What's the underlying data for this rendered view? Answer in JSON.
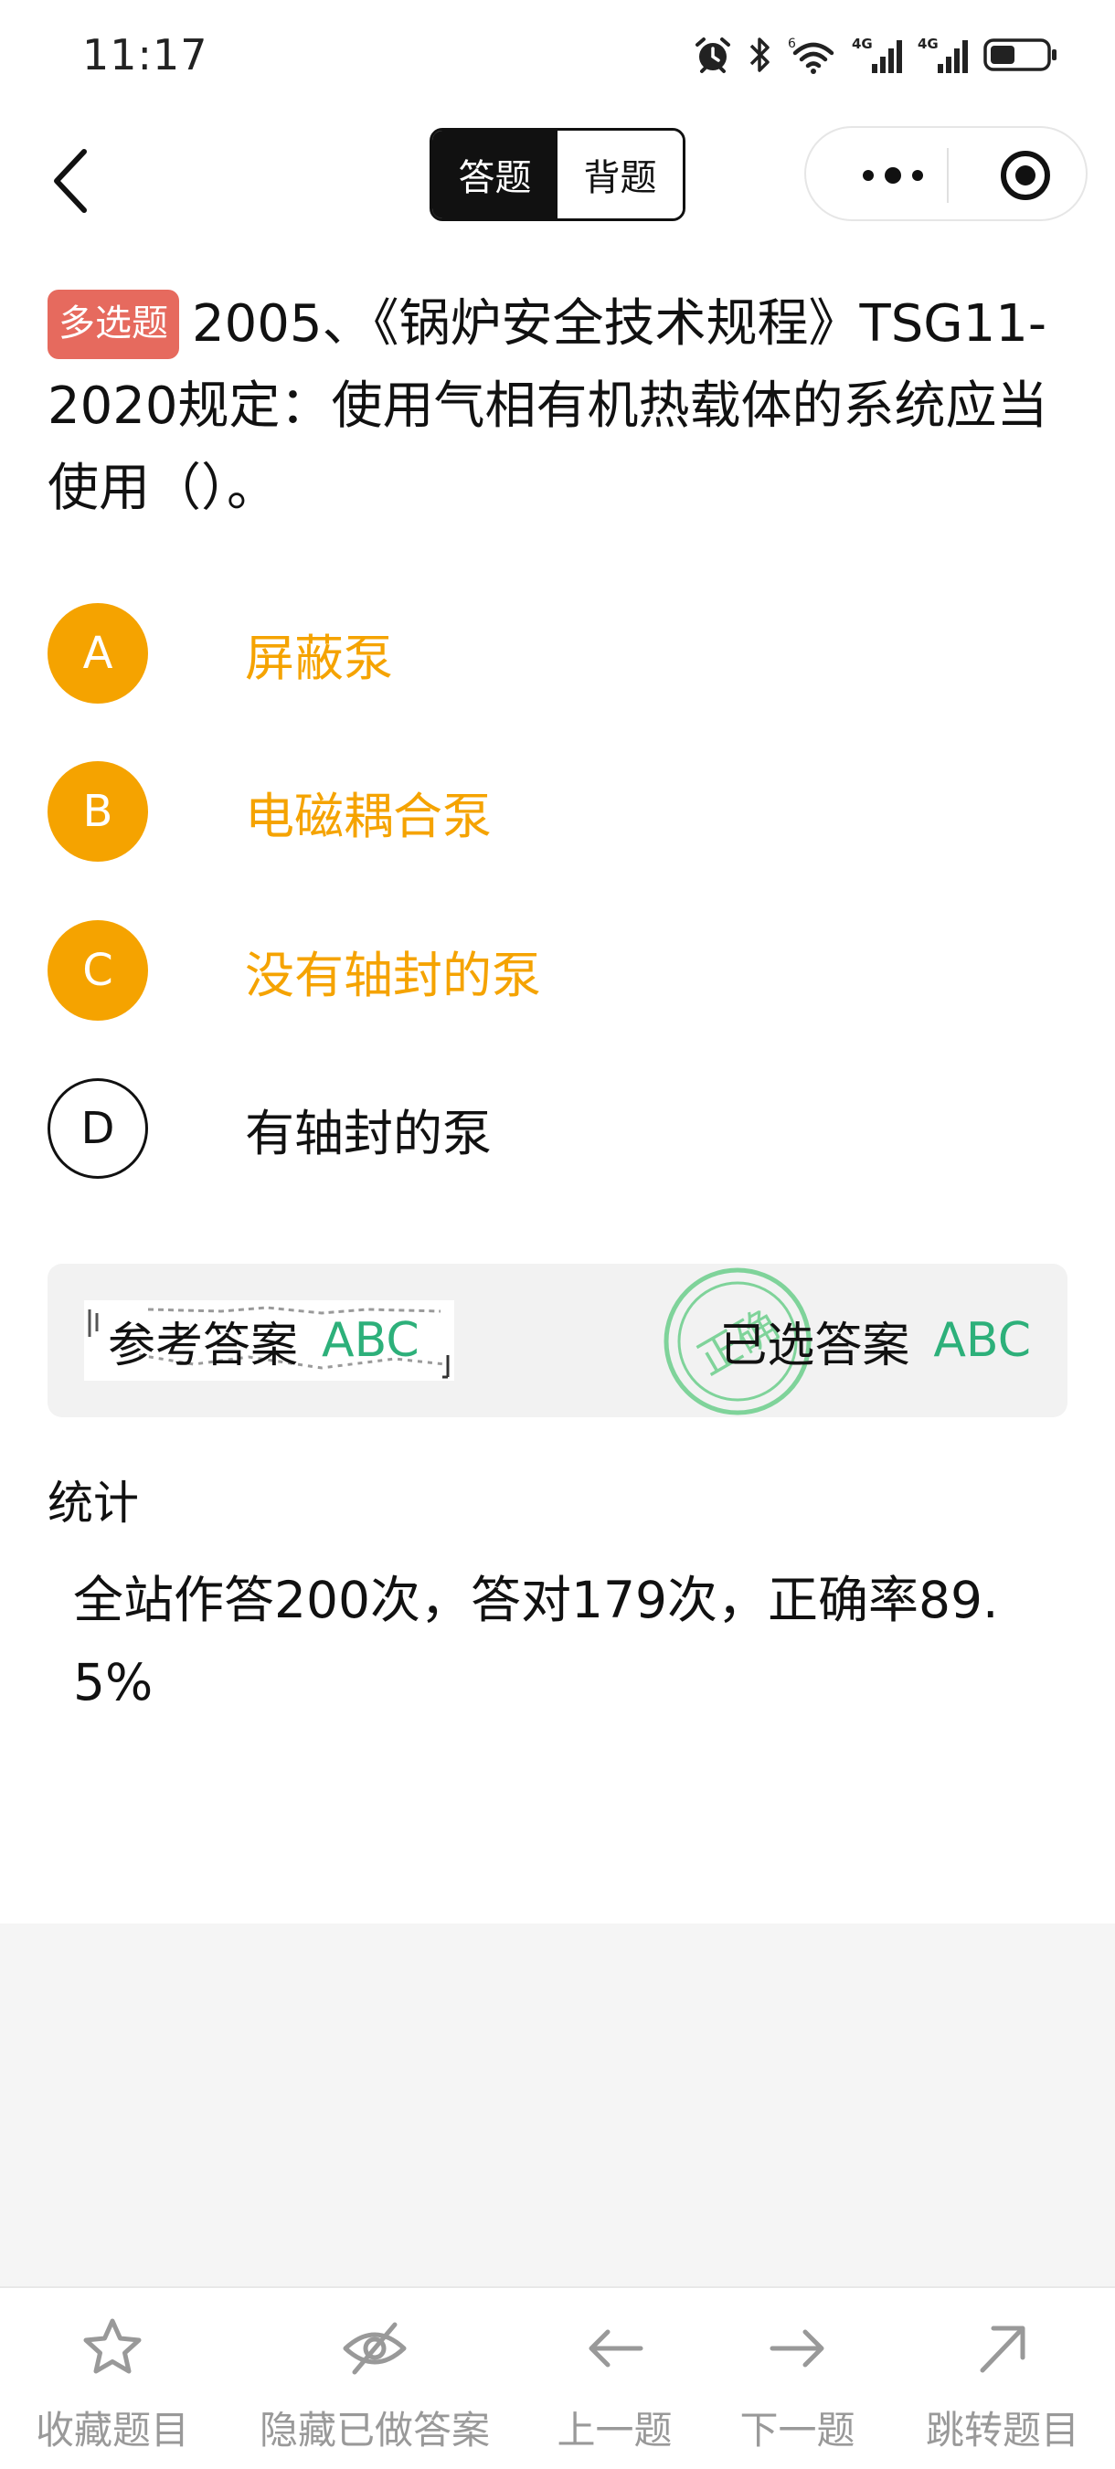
{
  "status_bar": {
    "time": "11:17",
    "icons": [
      "alarm-icon",
      "bluetooth-icon",
      "wifi-icon",
      "signal-4g-icon",
      "signal-4g-icon",
      "battery-icon"
    ],
    "wifi_badge": "6",
    "network_1": "4G",
    "network_2": "4G"
  },
  "nav": {
    "back_icon": "chevron-left-icon",
    "tabs": [
      {
        "label": "答题",
        "active": true
      },
      {
        "label": "背题",
        "active": false
      }
    ],
    "capsule_icons": [
      "more-icon",
      "target-icon"
    ]
  },
  "question": {
    "type_badge": "多选题",
    "text": "2005、《锅炉安全技术规程》TSG11-2020规定：使用气相有机热载体的系统应当使用（）。"
  },
  "options": [
    {
      "letter": "A",
      "text": "屏蔽泵",
      "selected": true
    },
    {
      "letter": "B",
      "text": "电磁耦合泵",
      "selected": true
    },
    {
      "letter": "C",
      "text": "没有轴封的泵",
      "selected": true
    },
    {
      "letter": "D",
      "text": "有轴封的泵",
      "selected": false
    }
  ],
  "answer": {
    "reference_label": "参考答案",
    "reference_value": "ABC",
    "chosen_label": "已选答案",
    "chosen_value": "ABC",
    "stamp_text": "正确"
  },
  "stats": {
    "title": "统计",
    "text": "全站作答200次，答对179次，正确率89.5%"
  },
  "bottom_tabs": [
    {
      "label": "收藏题目",
      "icon": "star-icon"
    },
    {
      "label": "隐藏已做答案",
      "icon": "eye-hide-icon"
    },
    {
      "label": "上一题",
      "icon": "arrow-left-icon"
    },
    {
      "label": "下一题",
      "icon": "arrow-right-icon"
    },
    {
      "label": "跳转题目",
      "icon": "arrow-up-right-icon"
    }
  ],
  "colors": {
    "selected_option": "#f5a300",
    "answer_value": "#2db07a",
    "badge": "#e66a5e",
    "tab_label": "#999999"
  }
}
